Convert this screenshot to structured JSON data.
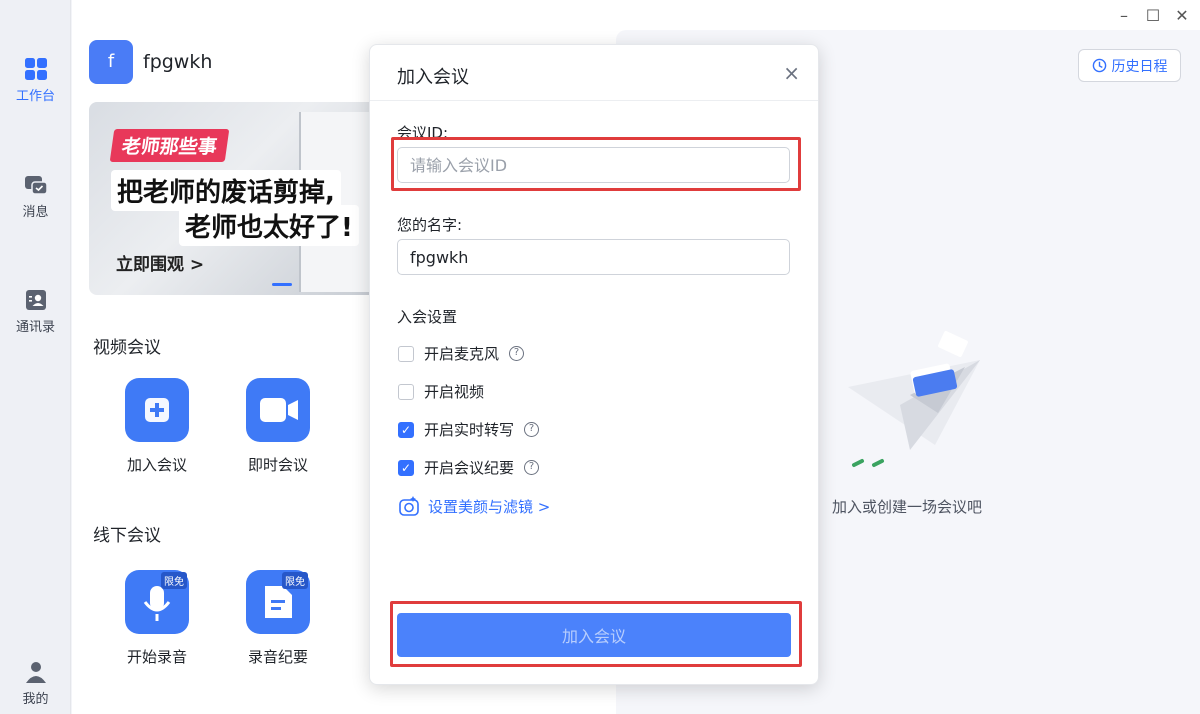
{
  "nav": {
    "items": [
      {
        "label": "工作台",
        "icon": "grid-icon",
        "active": true
      },
      {
        "label": "消息",
        "icon": "chat-icon"
      },
      {
        "label": "通讯录",
        "icon": "contacts-icon"
      },
      {
        "label": "我的",
        "icon": "person-icon"
      }
    ]
  },
  "user": {
    "initial": "f",
    "name": "fpgwkh"
  },
  "banner": {
    "tag": "老师那些事",
    "line1": "把老师的废话剪掉,",
    "line2": "老师也太好了!",
    "cta": "立即围观 >"
  },
  "video_section": {
    "title": "视频会议",
    "tiles": [
      {
        "label": "加入会议",
        "icon": "plus-icon"
      },
      {
        "label": "即时会议",
        "icon": "video-camera-icon"
      }
    ]
  },
  "offline_section": {
    "title": "线下会议",
    "tiles": [
      {
        "label": "开始录音",
        "icon": "microphone-icon",
        "badge": "限免"
      },
      {
        "label": "录音纪要",
        "icon": "document-icon",
        "badge": "限免"
      }
    ]
  },
  "right_panel": {
    "history_button": "历史日程",
    "empty_text": "加入或创建一场会议吧"
  },
  "dialog": {
    "title": "加入会议",
    "meeting_id_label": "会议ID:",
    "meeting_id_value": "",
    "meeting_id_placeholder": "请输入会议ID",
    "name_label": "您的名字:",
    "name_value": "fpgwkh",
    "settings_title": "入会设置",
    "options": [
      {
        "label": "开启麦克风",
        "checked": false,
        "help": true
      },
      {
        "label": "开启视频",
        "checked": false,
        "help": false
      },
      {
        "label": "开启实时转写",
        "checked": true,
        "help": true
      },
      {
        "label": "开启会议纪要",
        "checked": true,
        "help": true
      }
    ],
    "beauty_link": "设置美颜与滤镜 >",
    "join_button": "加入会议"
  },
  "colors": {
    "accent": "#3370ff",
    "highlight": "#e03c3c"
  }
}
